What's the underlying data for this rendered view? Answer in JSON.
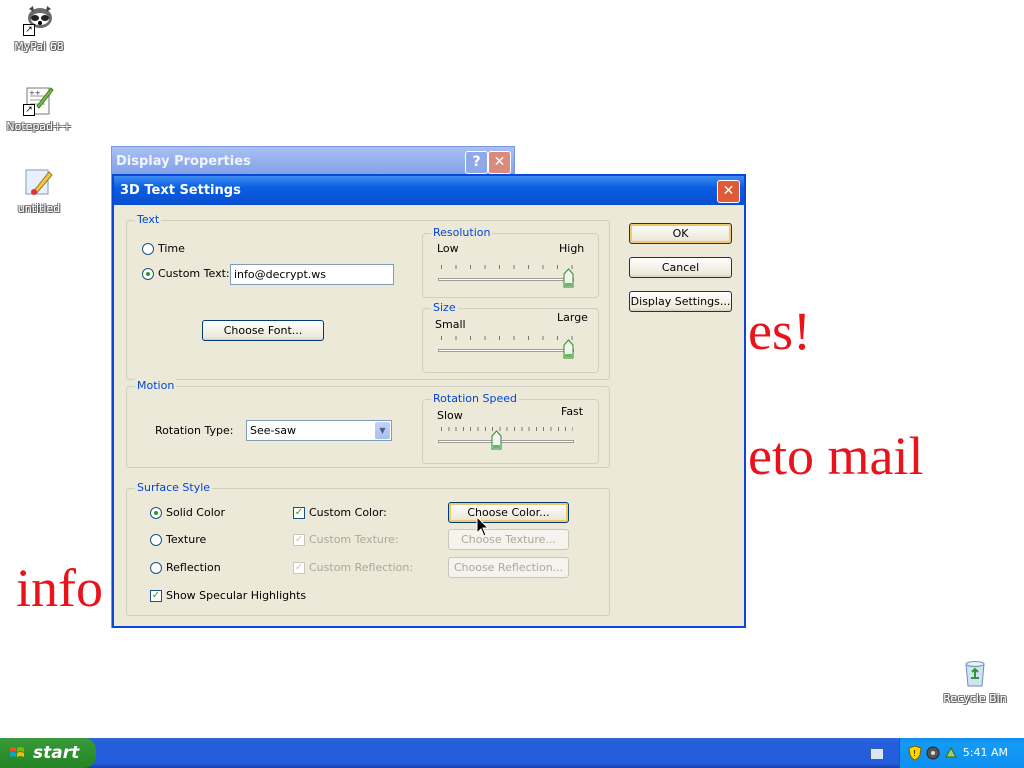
{
  "desktop": {
    "icons": [
      {
        "label": "MyPal 68",
        "icon": "raccoon-icon"
      },
      {
        "label": "Notepad++",
        "icon": "notepad-plus-icon"
      },
      {
        "label": "untitled",
        "icon": "paint-brush-icon"
      },
      {
        "label": "Recycle Bin",
        "icon": "recycle-bin-icon"
      }
    ],
    "red_texts": [
      "es!",
      "eto mail",
      "info"
    ]
  },
  "background_dialog": {
    "title": "Display Properties",
    "help_label": "?",
    "close_label": "✕"
  },
  "dialog": {
    "title": "3D Text Settings",
    "close_label": "✕",
    "text_group": {
      "legend": "Text",
      "time_label": "Time",
      "custom_text_label": "Custom Text:",
      "custom_text_value": "info@decrypt.ws",
      "choose_font_label": "Choose Font..."
    },
    "resolution": {
      "legend": "Resolution",
      "low": "Low",
      "high": "High",
      "level": 1.0
    },
    "size": {
      "legend": "Size",
      "small": "Small",
      "large": "Large",
      "level": 1.0
    },
    "motion": {
      "legend": "Motion",
      "rotation_type_label": "Rotation Type:",
      "rotation_type_value": "See-saw"
    },
    "rotation_speed": {
      "legend": "Rotation Speed",
      "slow": "Slow",
      "fast": "Fast",
      "level": 0.42
    },
    "surface": {
      "legend": "Surface Style",
      "solid_color": "Solid Color",
      "texture": "Texture",
      "reflection": "Reflection",
      "show_specular": "Show Specular Highlights",
      "custom_color": "Custom Color:",
      "custom_texture": "Custom Texture:",
      "custom_reflection": "Custom Reflection:",
      "choose_color": "Choose Color...",
      "choose_texture": "Choose Texture...",
      "choose_reflection": "Choose Reflection..."
    },
    "buttons": {
      "ok": "OK",
      "cancel": "Cancel",
      "display_settings": "Display Settings..."
    }
  },
  "taskbar": {
    "start_label": "start",
    "clock": "5:41 AM"
  },
  "colors": {
    "title_blue": "#0a4ed0",
    "taskbar_blue": "#245edc",
    "start_green": "#2d8f2d",
    "red_text": "#e8141c"
  }
}
